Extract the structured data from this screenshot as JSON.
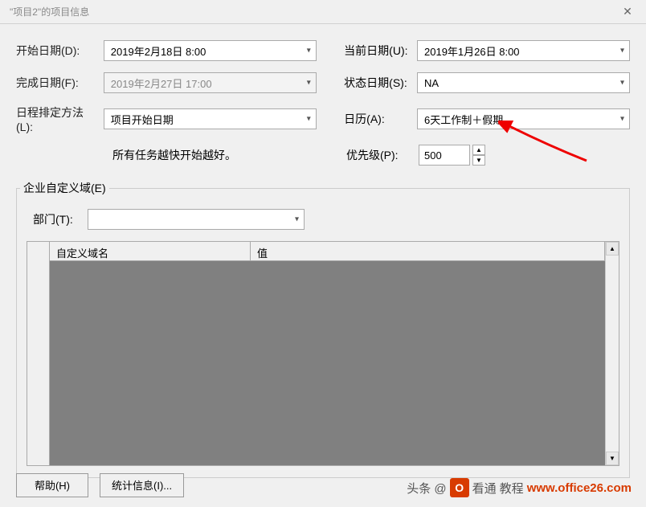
{
  "titlebar": {
    "title": "\"项目2\"的项目信息"
  },
  "form": {
    "start_date_label": "开始日期(D):",
    "start_date_value": "2019年2月18日 8:00",
    "current_date_label": "当前日期(U):",
    "current_date_value": "2019年1月26日 8:00",
    "finish_date_label": "完成日期(F):",
    "finish_date_value": "2019年2月27日 17:00",
    "status_date_label": "状态日期(S):",
    "status_date_value": "NA",
    "schedule_from_label": "日程排定方法(L):",
    "schedule_from_value": "项目开始日期",
    "calendar_label": "日历(A):",
    "calendar_value": "6天工作制＋假期",
    "hint_text": "所有任务越快开始越好。",
    "priority_label": "优先级(P):",
    "priority_value": "500"
  },
  "enterprise": {
    "legend": "企业自定义域(E)",
    "dept_label": "部门(T):",
    "dept_value": "",
    "col1": "自定义域名",
    "col2": "值"
  },
  "footer": {
    "help": "帮助(H)",
    "stats": "统计信息(I)..."
  },
  "watermark": {
    "text1": "头条 @",
    "text2": "看通",
    "text3": "教程",
    "link": "www.office26.com"
  }
}
